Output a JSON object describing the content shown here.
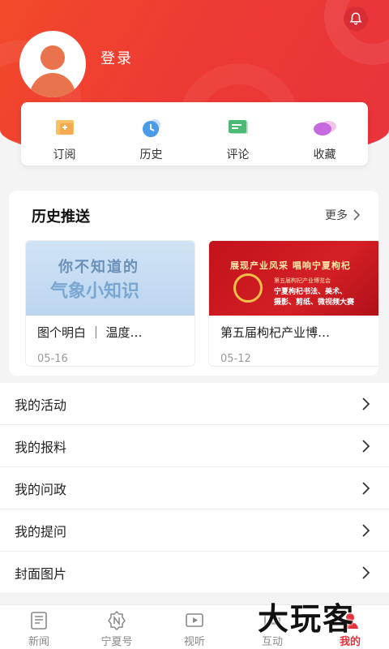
{
  "header": {
    "login_label": "登录",
    "accent_color": "#ee3a34"
  },
  "quick_actions": [
    {
      "label": "订阅",
      "icon": "subscribe-icon"
    },
    {
      "label": "历史",
      "icon": "clock-icon"
    },
    {
      "label": "评论",
      "icon": "comment-icon"
    },
    {
      "label": "收藏",
      "icon": "favorite-icon"
    }
  ],
  "history": {
    "title": "历史推送",
    "more_label": "更多",
    "items": [
      {
        "title": "图个明白 ｜ 温度…",
        "date": "05-16",
        "thumb_line1": "你不知道的",
        "thumb_line2": "气象小知识"
      },
      {
        "title": "第五届枸杞产业博…",
        "date": "05-12",
        "thumb_headline": "展现产业风采  唱响宁夏枸杞",
        "thumb_sub1": "第五届枸杞产业博览会",
        "thumb_sub2": "宁夏枸杞书法、美术、",
        "thumb_sub3": "摄影、剪纸、微视频大赛"
      }
    ]
  },
  "menu": [
    {
      "label": "我的活动"
    },
    {
      "label": "我的报料"
    },
    {
      "label": "我的问政"
    },
    {
      "label": "我的提问"
    },
    {
      "label": "封面图片"
    }
  ],
  "tabs": [
    {
      "label": "新闻",
      "icon": "news-icon"
    },
    {
      "label": "宁夏号",
      "icon": "ningxia-icon"
    },
    {
      "label": "视听",
      "icon": "video-icon"
    },
    {
      "label": "互动",
      "icon": "interact-icon"
    },
    {
      "label": "我的",
      "icon": "profile-icon",
      "active": true
    }
  ],
  "watermark": "大玩客"
}
